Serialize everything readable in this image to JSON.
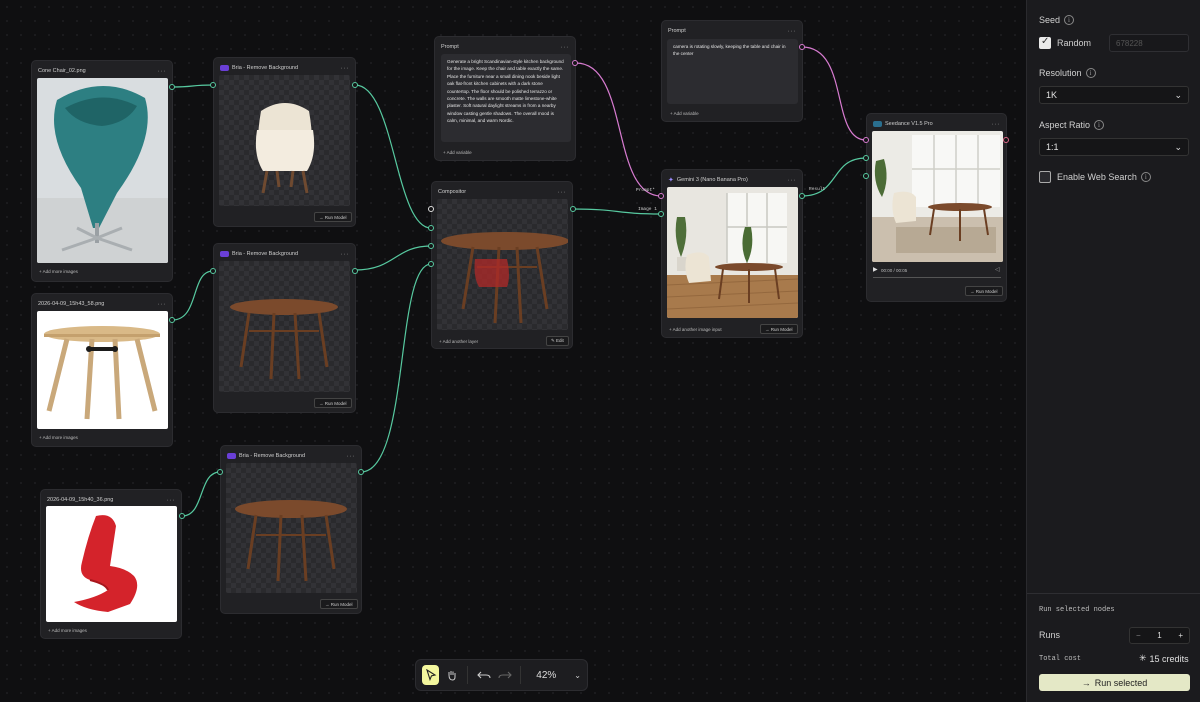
{
  "canvas": {
    "nodes": {
      "cone_chair": {
        "title": "Cone Chair_02.png",
        "footer": "+ Add more images"
      },
      "table_image": {
        "title": "2026-04-09_15h43_58.png",
        "footer": "+ Add more images"
      },
      "red_chair": {
        "title": "2026-04-09_15h40_36.png",
        "footer": "+ Add more images"
      },
      "bria_1": {
        "title": "Bria - Remove Background",
        "button": "→ Run Model"
      },
      "bria_2": {
        "title": "Bria - Remove Background",
        "button": "→ Run Model"
      },
      "bria_3": {
        "title": "Bria - Remove Background",
        "button": "→ Run Model"
      },
      "prompt_1": {
        "title": "Prompt",
        "text": "Generate a bright Scandinavian-style kitchen background for the image. Keep the chair and table exactly the same. Place the furniture near a small dining nook beside light oak flat-front kitchen cabinets with a dark stone countertop. The floor should be polished terrazzo or concrete. The walls are smooth matte limestone-white plaster. Soft natural daylight streams in from a nearby window casting gentle shadows. The overall mood is calm, minimal, and warm Nordic.",
        "footer": "+ Add variable"
      },
      "prompt_2": {
        "title": "Prompt",
        "text": "camera is rotating slowly, keeping the table and chair in the center",
        "footer": "+ Add variable"
      },
      "compositor": {
        "title": "Compositor",
        "footer": "+ Add another layer",
        "button": "✎ Edit"
      },
      "gemini": {
        "title": "Gemini 3 (Nano Banana Pro)",
        "footer": "+ Add another image input",
        "button": "→ Run Model"
      },
      "seedance": {
        "title": "Seedance V1.5 Pro",
        "time": "00:00 / 00:05",
        "button": "→ Run Model"
      }
    },
    "wire_labels": {
      "prompt": "Prompt*",
      "image1": "Image 1",
      "result": "Result"
    }
  },
  "toolbar": {
    "zoom": "42%"
  },
  "panel": {
    "seed_label": "Seed",
    "random_label": "Random",
    "random_checked": true,
    "seed_value": "678228",
    "resolution_label": "Resolution",
    "resolution_value": "1K",
    "aspect_label": "Aspect Ratio",
    "aspect_value": "1:1",
    "web_search_label": "Enable Web Search",
    "web_search_checked": false,
    "run_selected_header": "Run selected nodes",
    "runs_label": "Runs",
    "runs_value": "1",
    "stepper_minus": "−",
    "stepper_plus": "+",
    "total_cost_label": "Total cost",
    "total_cost_value": "15 credits",
    "run_button": "Run selected"
  },
  "colors": {
    "wire_green": "#57c9a0",
    "wire_pink": "#d77bd0",
    "accent_yellow": "#f4f79e",
    "run_button_bg": "#e4e8c6"
  }
}
